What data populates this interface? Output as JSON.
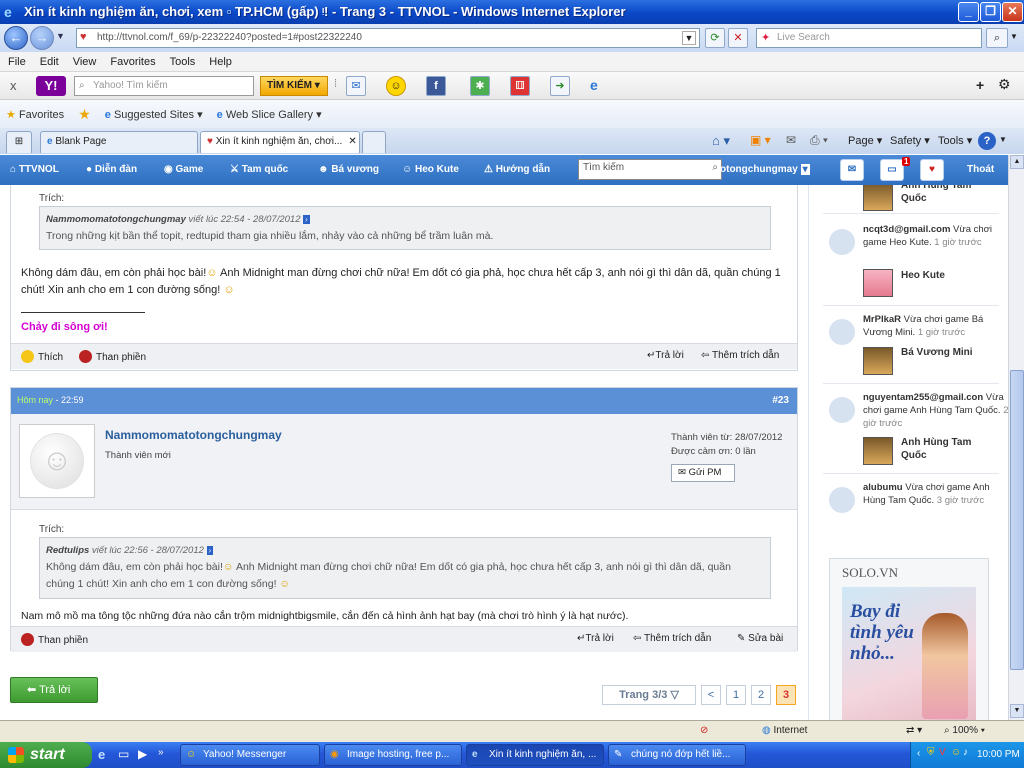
{
  "window": {
    "title": "Xin ít kinh nghiệm ăn, chơi, xem ▫ TP.HCM (gấp) ᵎ! - Trang 3 - TTVNOL - Windows Internet Explorer",
    "minimize": "_",
    "maximize": "❐",
    "close": "✕"
  },
  "address": {
    "url": "http://ttvnol.com/f_69/p-22322240?posted=1#post22322240",
    "live_search_placeholder": "Live Search"
  },
  "menu": [
    "File",
    "Edit",
    "View",
    "Favorites",
    "Tools",
    "Help"
  ],
  "yahoo": {
    "close": "x",
    "logo": "Y!",
    "search_placeholder": "Yahoo! Tìm kiếm",
    "search_button": "TÌM KIẾM"
  },
  "favorites": {
    "favorites_label": "Favorites",
    "suggested_sites": "Suggested Sites",
    "web_slice": "Web Slice Gallery"
  },
  "tabs": [
    {
      "label": "Blank Page"
    },
    {
      "label": "Xin ít kinh nghiệm ăn, chơi..."
    }
  ],
  "command_bar": {
    "page": "Page",
    "safety": "Safety",
    "tools": "Tools"
  },
  "site_nav": {
    "items": [
      "TTVNOL",
      "Diễn đàn",
      "Game",
      "Tam quốc",
      "Bá vương",
      "Heo Kute",
      "Hướng dẫn"
    ],
    "search_placeholder": "Tìm kiếm",
    "username": "otongchungmay",
    "logout": "Thoát",
    "notification_count": "1"
  },
  "post1": {
    "quote_label": "Trích:",
    "quote_author": "Nammomomatotongchungmay",
    "quote_meta": "viết lúc 22:54 - 28/07/2012",
    "quote_text": "Trong những kịt bần thể topit, redtupid tham gia nhiều lắm, nhảy vào cả những bể trầm luân mà.",
    "body_line1": "Không dám đâu, em còn phải học bài!",
    "body_line1b": "Anh Midnight man đừng chơi chữ nữa! Em dốt có gia phả, học chưa hết cấp 3, anh nói gì thì dân dã, quần chúng 1",
    "body_line2": "chút! Xin anh cho em 1 con đường sống!",
    "signature": "Chảy đi sông ơi!",
    "like": "Thích",
    "complain": "Than phiền",
    "reply": "Trả lời",
    "multiquote": "Thêm trích dẫn"
  },
  "post2": {
    "date_today": "Hôm nay",
    "time": "22:59",
    "number": "#23",
    "username": "Nammomomatotongchungmay",
    "rank": "Thành viên mới",
    "joined": "Thành viên từ: 28/07/2012",
    "thanked": "Được cảm ơn: 0 lần",
    "send_pm": "Gửi PM",
    "quote_label": "Trích:",
    "quote_author": "Redtulips",
    "quote_meta": "viết lúc 22:56 - 28/07/2012",
    "quote_line1": "Không dám đâu, em còn phải học bài!",
    "quote_line1b": "Anh Midnight man đừng chơi chữ nữa! Em dốt có gia phả, học chưa hết cấp 3, anh nói gì thì dân dã, quần",
    "quote_line2": "chúng 1 chút! Xin anh cho em 1 con đường sống!",
    "body": "Nam mô mồ ma tông tộc những đứa nào cắn trộm midnightbigsmile, cắn đến cả hình ảnh hạt bay (mà chơi trò hình ý là hạt nước).",
    "complain": "Than phiền",
    "reply": "Trả lời",
    "multiquote": "Thêm trích dẫn",
    "edit": "Sửa bài"
  },
  "reply_button": "Trả lời",
  "pagination": {
    "label": "Trang 3/3",
    "prev": "<",
    "pages": [
      "1",
      "2",
      "3"
    ],
    "current": "3"
  },
  "sidebar": {
    "top_game": "Anh Hùng Tam Quốc",
    "activities": [
      {
        "user": "ncqt3d@gmail.com",
        "text": "Vừa chơi game Heo Kute.",
        "time": "1 giờ trước",
        "game": "Heo Kute"
      },
      {
        "user": "MrPlkaR",
        "text": "Vừa chơi game Bá Vương Mini.",
        "time": "1 giờ trước",
        "game": "Bá Vương Mini"
      },
      {
        "user": "nguyentam255@gmail.con",
        "text": "Vừa chơi game Anh Hùng Tam Quốc.",
        "time": "2 giờ trước",
        "game": "Anh Hùng Tam Quốc"
      },
      {
        "user": "alubumu",
        "text": "Vừa chơi game Anh Hùng Tam Quốc.",
        "time": "3 giờ trước"
      }
    ],
    "ad_title": "SOLO.VN",
    "ad_text": "Bay đi tình yêu nhỏ..."
  },
  "status_bar": {
    "zone": "Internet",
    "zoom": "100%"
  },
  "taskbar": {
    "start": "start",
    "tasks": [
      "Yahoo! Messenger",
      "Image hosting, free p...",
      "Xin ít kinh nghiệm ăn, ...",
      "chúng nó đớp hết liề..."
    ],
    "clock": "10:00 PM"
  },
  "colors": {
    "nav_blue": "#3a7ccc",
    "reply_green": "#4caf3e",
    "current_page": "#f5a623",
    "signature": "#d400d4"
  }
}
